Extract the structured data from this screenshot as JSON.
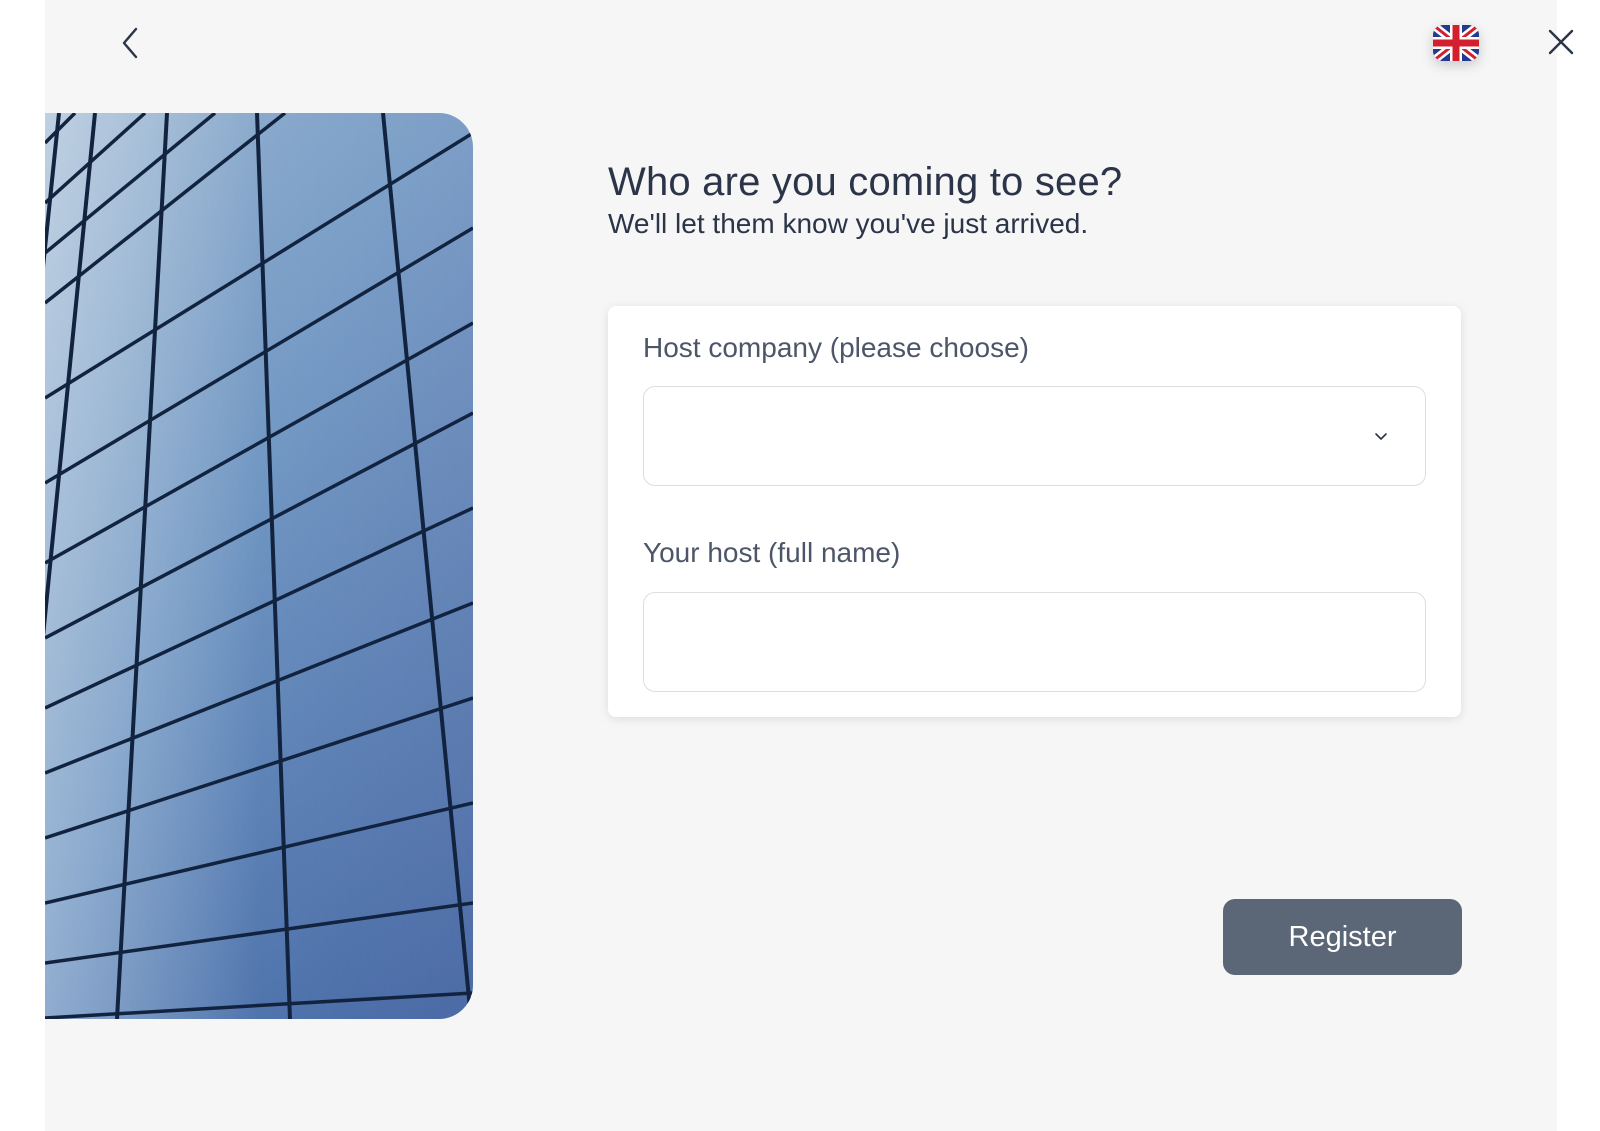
{
  "nav": {
    "back_icon": "chevron-left-icon",
    "close_icon": "close-icon",
    "language": {
      "icon": "uk-flag-icon"
    }
  },
  "content": {
    "title": "Who are you coming to see?",
    "subtitle": "We'll let them know you've just arrived."
  },
  "form": {
    "company": {
      "label": "Host company (please choose)",
      "value": "",
      "icon": "chevron-down-icon"
    },
    "host": {
      "label": "Your host (full name)",
      "value": "",
      "placeholder": ""
    }
  },
  "actions": {
    "register_label": "Register"
  },
  "colors": {
    "background": "#f6f6f6",
    "card": "#ffffff",
    "text": "#2b3448",
    "label": "#4c5668",
    "button": "#5b6676",
    "image_blue": "#4f79b0"
  }
}
